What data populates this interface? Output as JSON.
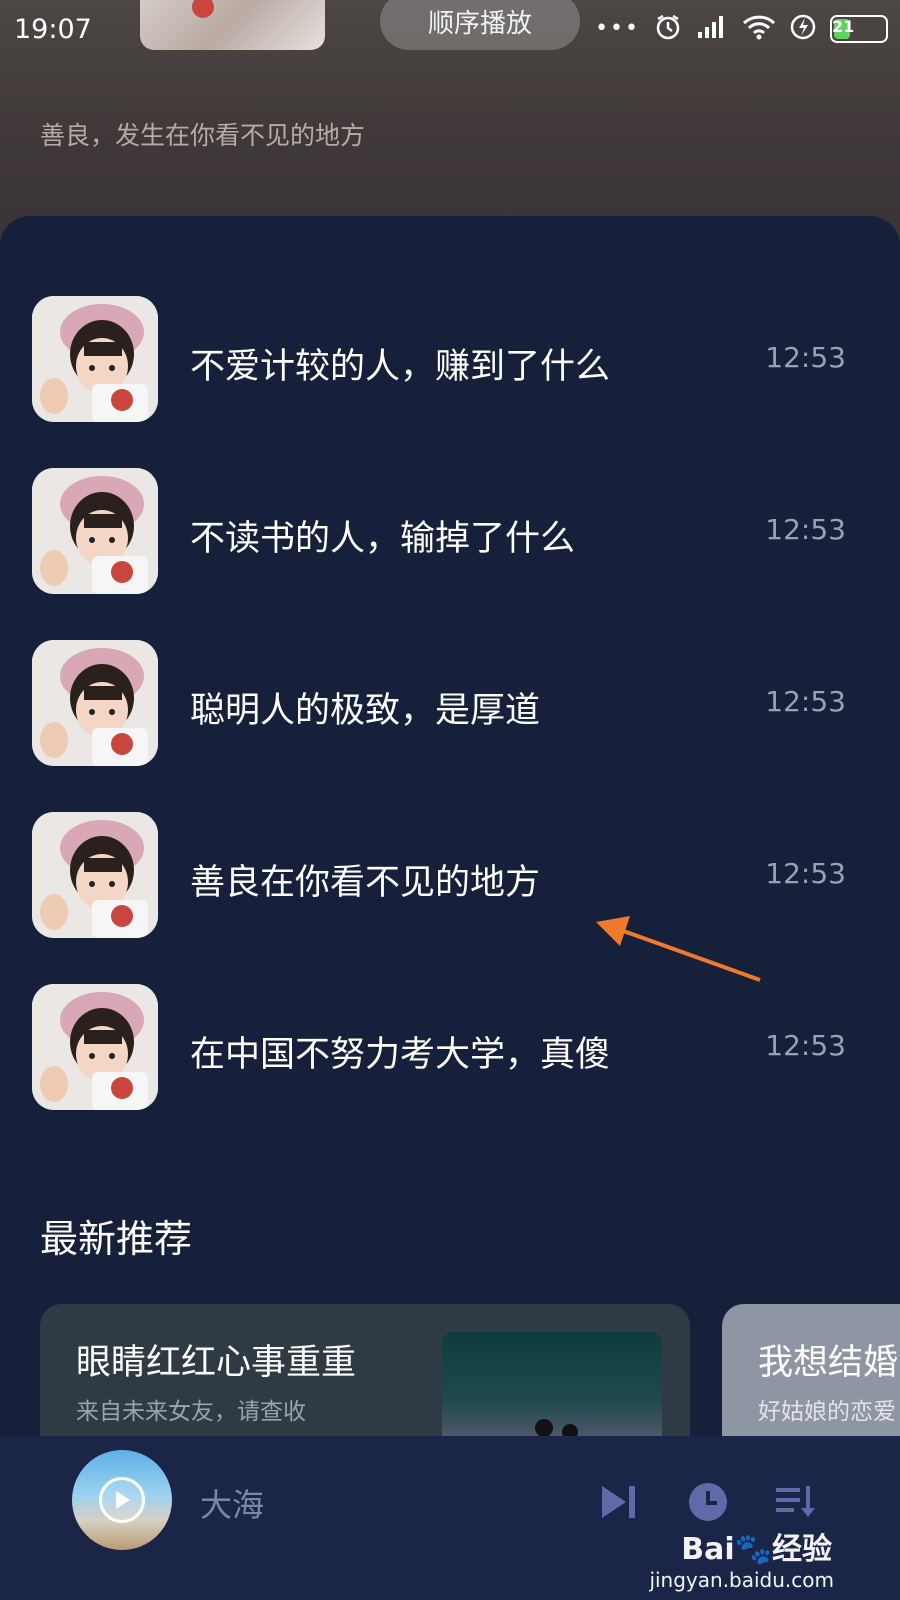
{
  "status_bar": {
    "time": "19:07",
    "battery": "21"
  },
  "header": {
    "order_mode": "顺序播放",
    "subtitle": "善良，发生在你看不见的地方"
  },
  "tracks": [
    {
      "title": "不爱计较的人，赚到了什么",
      "time": "12:53"
    },
    {
      "title": "不读书的人，输掉了什么",
      "time": "12:53"
    },
    {
      "title": "聪明人的极致，是厚道",
      "time": "12:53"
    },
    {
      "title": "善良在你看不见的地方",
      "time": "12:53"
    },
    {
      "title": "在中国不努力考大学，真傻",
      "time": "12:53"
    }
  ],
  "recommend": {
    "section_title": "最新推荐",
    "cards": [
      {
        "title": "眼睛红红心事重重",
        "subtitle": "来自未来女友，请查收"
      },
      {
        "title": "我想结婚",
        "subtitle": "好姑娘的恋爱"
      }
    ]
  },
  "player": {
    "current_song": "大海"
  },
  "watermark": {
    "brand": "Bai🐾经验",
    "url": "jingyan.baidu.com"
  },
  "colors": {
    "panel_bg": "#17203a",
    "player_bg": "#1b2547",
    "arrow": "#f07a2c"
  }
}
